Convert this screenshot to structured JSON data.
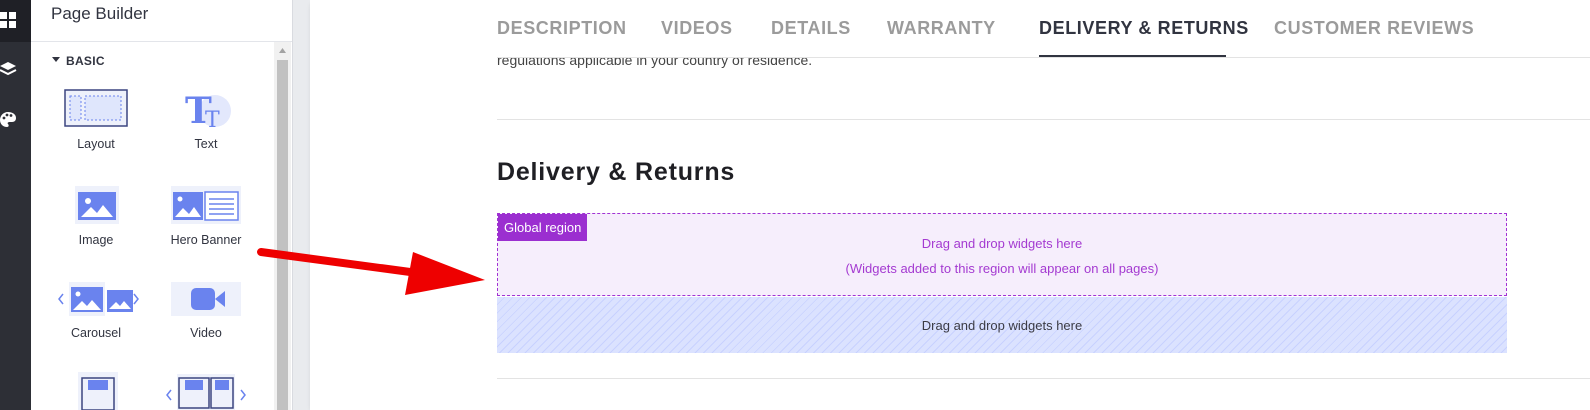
{
  "rail": {
    "icons": [
      "widgets-icon",
      "layers-icon",
      "palette-icon"
    ]
  },
  "panel": {
    "title": "Page Builder",
    "section": "BASIC",
    "widgets": [
      {
        "label": "Layout",
        "icon": "layout-icon"
      },
      {
        "label": "Text",
        "icon": "text-icon"
      },
      {
        "label": "Image",
        "icon": "image-icon"
      },
      {
        "label": "Hero Banner",
        "icon": "hero-banner-icon"
      },
      {
        "label": "Carousel",
        "icon": "carousel-icon"
      },
      {
        "label": "Video",
        "icon": "video-icon"
      }
    ]
  },
  "canvas": {
    "tabs": [
      "DESCRIPTION",
      "VIDEOS",
      "DETAILS",
      "WARRANTY",
      "DELIVERY & RETURNS",
      "CUSTOMER REVIEWS"
    ],
    "active_tab": "DELIVERY & RETURNS",
    "cut_text": "regulations applicable in your country of residence.",
    "heading": "Delivery & Returns",
    "global_region": {
      "tag": "Global region",
      "line1": "Drag and drop widgets here",
      "line2": "(Widgets added to this region will appear on all pages)"
    },
    "drop_zone": "Drag and drop widgets here"
  },
  "colors": {
    "accent_blue": "#6a83ee",
    "global_purple": "#9b2fd0",
    "arrow_red": "#ee0000"
  }
}
